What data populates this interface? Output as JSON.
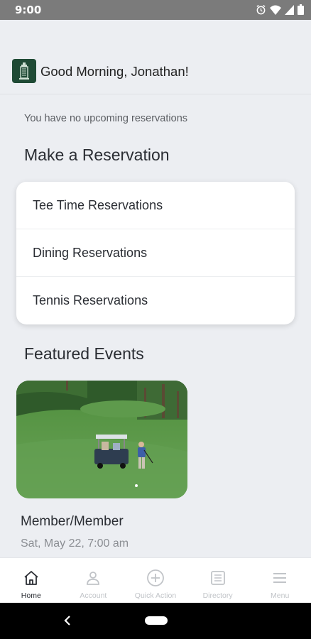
{
  "status": {
    "time": "9:00"
  },
  "header": {
    "greeting": "Good Morning, Jonathan!"
  },
  "notice": "You have no upcoming reservations",
  "reservations": {
    "title": "Make a Reservation",
    "items": [
      {
        "label": "Tee Time Reservations"
      },
      {
        "label": "Dining Reservations"
      },
      {
        "label": "Tennis Reservations"
      }
    ]
  },
  "events": {
    "title": "Featured Events",
    "items": [
      {
        "name": "Member/Member",
        "date": "Sat, May 22, 7:00 am"
      }
    ]
  },
  "nav": {
    "items": [
      {
        "label": "Home",
        "icon": "home-icon",
        "active": true
      },
      {
        "label": "Account",
        "icon": "person-icon",
        "active": false
      },
      {
        "label": "Quick Action",
        "icon": "plus-circle-icon",
        "active": false
      },
      {
        "label": "Directory",
        "icon": "directory-icon",
        "active": false
      },
      {
        "label": "Menu",
        "icon": "menu-icon",
        "active": false
      }
    ]
  },
  "colors": {
    "brand": "#1f4a35",
    "background": "#eceef2",
    "active": "#2a2d33",
    "inactive": "#c1c4c8"
  }
}
